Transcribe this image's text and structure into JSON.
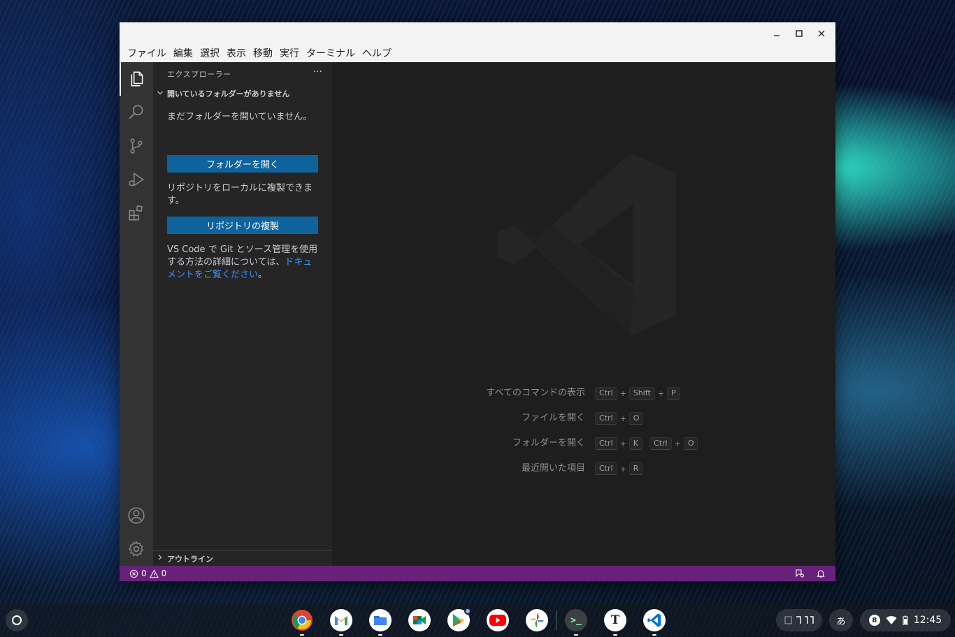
{
  "window": {
    "controls": {
      "minimize": "—",
      "maximize": "□",
      "close": "✕"
    },
    "menu": [
      "ファイル",
      "編集",
      "選択",
      "表示",
      "移動",
      "実行",
      "ターミナル",
      "ヘルプ"
    ]
  },
  "activitybar": {
    "top": [
      "explorer-icon",
      "search-icon",
      "source-control-icon",
      "run-debug-icon",
      "extensions-icon"
    ],
    "bottom": [
      "accounts-icon",
      "manage-gear-icon"
    ]
  },
  "sidebar": {
    "title": "エクスプローラー",
    "more": "···",
    "section_title": "開いているフォルダーがありません",
    "no_folder_text": "まだフォルダーを開いていません。",
    "open_folder_button": "フォルダーを開く",
    "clone_text": "リポジトリをローカルに複製できます。",
    "clone_button": "リポジトリの複製",
    "docs_text_prefix": "VS Code で Git とソース管理を使用する方法の詳細については、",
    "docs_link": "ドキュメントをご覧ください",
    "docs_text_suffix": "。",
    "outline_title": "アウトライン"
  },
  "editor": {
    "shortcuts": [
      {
        "label": "すべてのコマンドの表示",
        "keys": [
          [
            "Ctrl",
            "Shift",
            "P"
          ]
        ]
      },
      {
        "label": "ファイルを開く",
        "keys": [
          [
            "Ctrl",
            "O"
          ]
        ]
      },
      {
        "label": "フォルダーを開く",
        "keys": [
          [
            "Ctrl",
            "K"
          ],
          [
            "Ctrl",
            "O"
          ]
        ]
      },
      {
        "label": "最近開いた項目",
        "keys": [
          [
            "Ctrl",
            "R"
          ]
        ]
      }
    ]
  },
  "statusbar": {
    "errors": "0",
    "warnings": "0",
    "color": "#68217a"
  },
  "shelf": {
    "apps": [
      "chrome",
      "gmail",
      "files",
      "meet",
      "play-store",
      "youtube",
      "photos",
      "terminal",
      "text",
      "vscode"
    ],
    "terminal_glyph": ">_",
    "text_glyph": "T",
    "ime": "あ",
    "notification_count": "8",
    "time": "12:45"
  },
  "colors": {
    "editor_bg": "#1e1e1e",
    "sidebar_bg": "#252526",
    "activitybar_bg": "#333333",
    "button_bg": "#0e639c",
    "link": "#3794ff"
  }
}
